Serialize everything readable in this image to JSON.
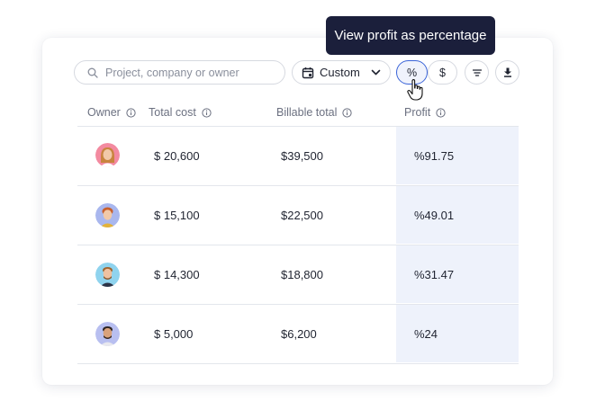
{
  "toolbar": {
    "search_placeholder": "Project, company or owner",
    "date_range_label": "Custom",
    "percent_toggle": "%",
    "currency_toggle": "$"
  },
  "tooltip": {
    "text": "View profit as percentage"
  },
  "table": {
    "headers": [
      "Owner",
      "Total cost",
      "Billable total",
      "Profit"
    ],
    "rows": [
      {
        "total_cost": "$ 20,600",
        "billable_total": "$39,500",
        "profit": "%91.75"
      },
      {
        "total_cost": "$ 15,100",
        "billable_total": "$22,500",
        "profit": "%49.01"
      },
      {
        "total_cost": "$ 14,300",
        "billable_total": "$18,800",
        "profit": "%31.47"
      },
      {
        "total_cost": "$ 5,000",
        "billable_total": "$6,200",
        "profit": "%24"
      }
    ]
  },
  "colors": {
    "accent": "#3a64d8",
    "tooltip_bg": "#1b1f3b",
    "profit_column_bg": "#eef2fb"
  }
}
